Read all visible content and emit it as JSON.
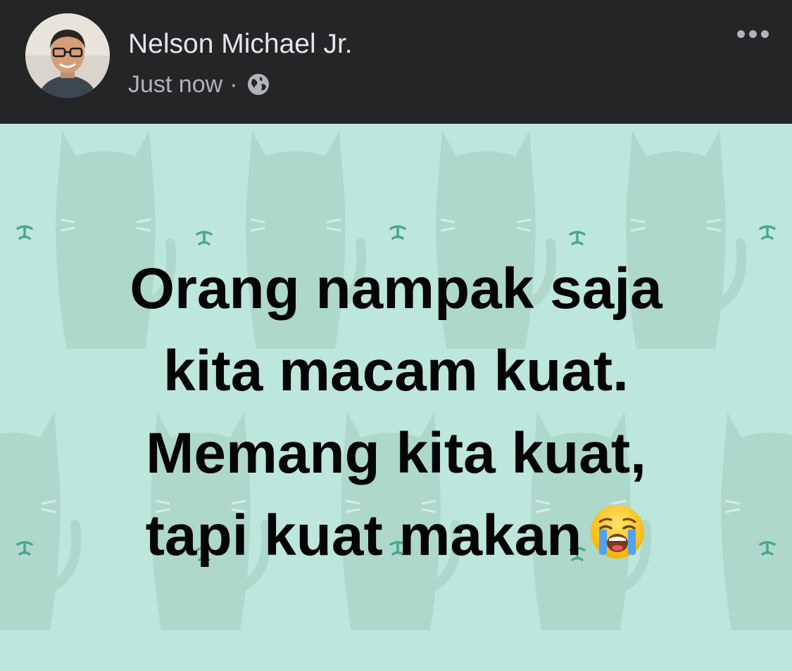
{
  "post": {
    "author": {
      "name": "Nelson Michael Jr.",
      "avatar": "avatar"
    },
    "timestamp": "Just now",
    "separator": "·",
    "audience_icon": "globe-icon",
    "more_icon": "more-horizontal-icon",
    "text_lines": [
      "Orang nampak saja",
      "kita macam kuat.",
      "Memang kita kuat,",
      "tapi kuat makan"
    ],
    "emoji": "loudly-crying-face-emoji",
    "background": {
      "color": "#bde6dd",
      "pattern": "cats",
      "accent": "#4aa88c"
    }
  },
  "colors": {
    "header_bg": "#242526",
    "name": "#e4e6eb",
    "meta": "#b0b3b8",
    "text": "#050505"
  }
}
